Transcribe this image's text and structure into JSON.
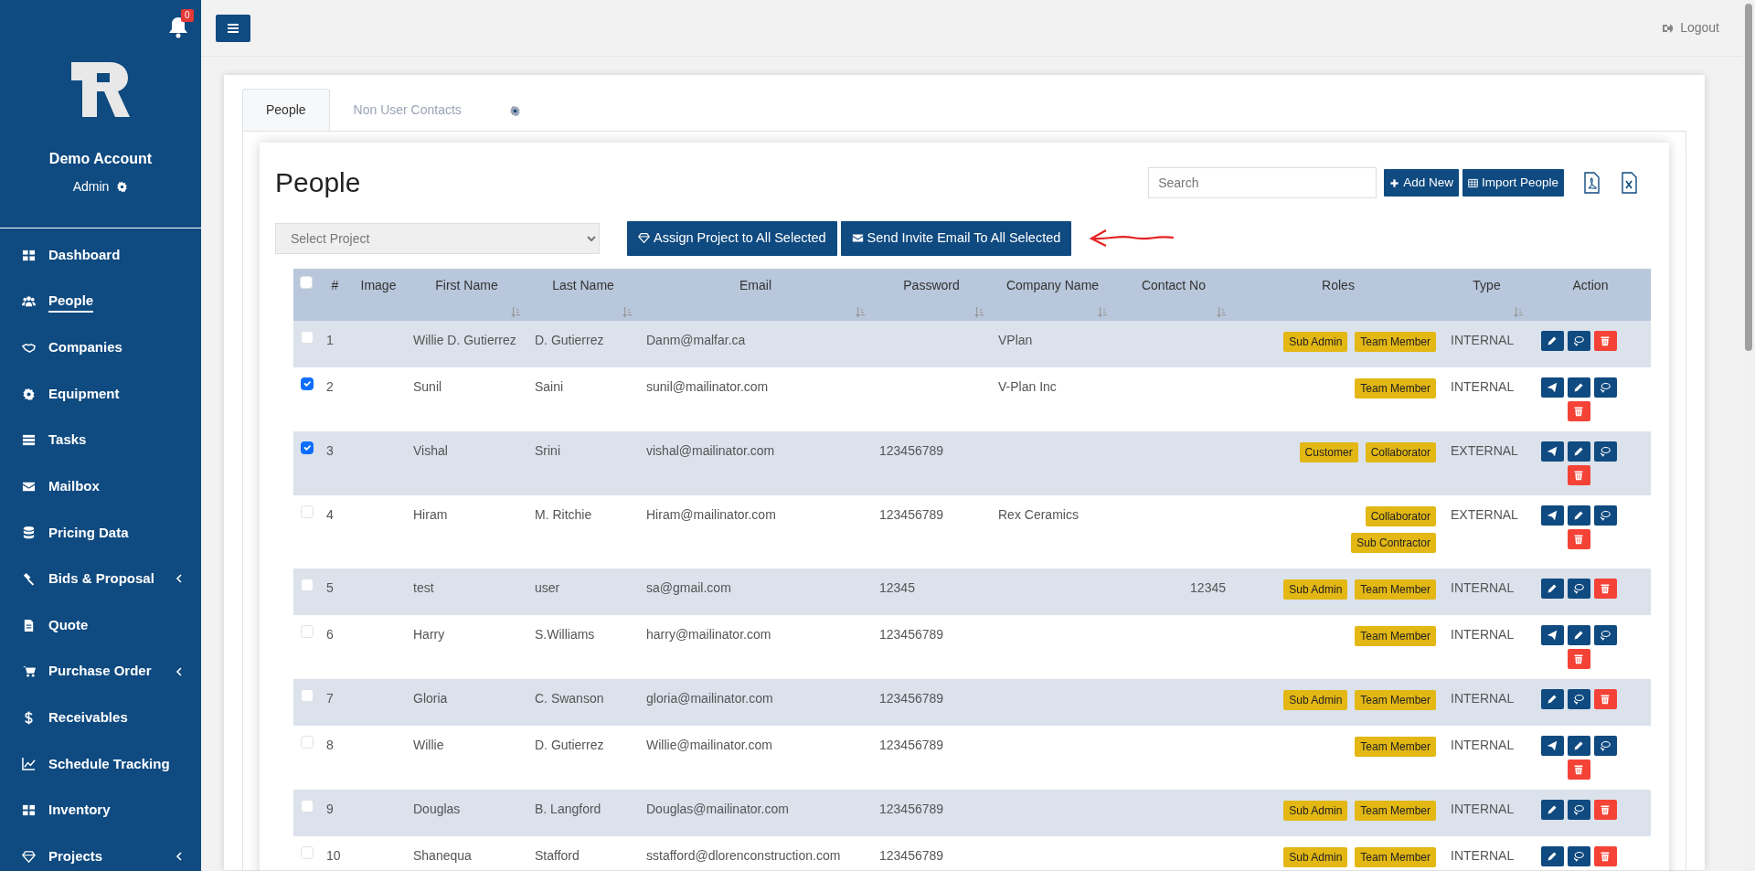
{
  "notifications": {
    "count": "0"
  },
  "account": {
    "name": "Demo Account",
    "role": "Admin"
  },
  "sidebar": {
    "items": [
      {
        "label": "Dashboard",
        "selected": false,
        "submenu": false
      },
      {
        "label": "People",
        "selected": true,
        "submenu": false
      },
      {
        "label": "Companies",
        "selected": false,
        "submenu": false
      },
      {
        "label": "Equipment",
        "selected": false,
        "submenu": false
      },
      {
        "label": "Tasks",
        "selected": false,
        "submenu": false
      },
      {
        "label": "Mailbox",
        "selected": false,
        "submenu": false
      },
      {
        "label": "Pricing Data",
        "selected": false,
        "submenu": false
      },
      {
        "label": "Bids & Proposal",
        "selected": false,
        "submenu": true
      },
      {
        "label": "Quote",
        "selected": false,
        "submenu": false
      },
      {
        "label": "Purchase Order",
        "selected": false,
        "submenu": true
      },
      {
        "label": "Receivables",
        "selected": false,
        "submenu": false
      },
      {
        "label": "Schedule Tracking",
        "selected": false,
        "submenu": false
      },
      {
        "label": "Inventory",
        "selected": false,
        "submenu": false
      },
      {
        "label": "Projects",
        "selected": false,
        "submenu": true
      }
    ]
  },
  "topbar": {
    "logout": "Logout"
  },
  "tabs": [
    {
      "kind": "text",
      "label": "People",
      "selected": true
    },
    {
      "kind": "text",
      "label": "Non User Contacts",
      "selected": false
    },
    {
      "kind": "icon",
      "selected": false
    }
  ],
  "title": "People",
  "search": {
    "placeholder": "Search"
  },
  "buttons": [
    {
      "label": "Add New"
    },
    {
      "label": "Import People"
    }
  ],
  "project_select": {
    "placeholder": "Select Project"
  },
  "bulk_buttons": [
    {
      "label": "Assign Project to All Selected"
    },
    {
      "label": "Send Invite Email To All Selected"
    }
  ],
  "annotation": {
    "kind": "arrow"
  },
  "table": {
    "all_checked": false,
    "columns": [
      {
        "label": "#",
        "sortable": false
      },
      {
        "label": "Image",
        "sortable": false
      },
      {
        "label": "First Name",
        "sortable": true
      },
      {
        "label": "Last Name",
        "sortable": true
      },
      {
        "label": "Email",
        "sortable": true
      },
      {
        "label": "Password",
        "sortable": true
      },
      {
        "label": "Company Name",
        "sortable": true
      },
      {
        "label": "Contact No",
        "sortable": true
      },
      {
        "label": "Roles",
        "sortable": false
      },
      {
        "label": "Type",
        "sortable": true
      },
      {
        "label": "Action",
        "sortable": false
      }
    ],
    "rows": [
      {
        "checked": false,
        "no": "1",
        "first": "Willie D. Gutierrez",
        "last": "D. Gutierrez",
        "email": "Danm@malfar.ca",
        "password": "",
        "company": "VPlan",
        "contact": "",
        "roles": [
          "Sub Admin",
          "Team Member"
        ],
        "type": "INTERNAL",
        "actions": [
          {
            "kind": "edit"
          },
          {
            "kind": "chat"
          },
          {
            "kind": "delete"
          }
        ]
      },
      {
        "checked": true,
        "no": "2",
        "first": "Sunil",
        "last": "Saini",
        "email": "sunil@mailinator.com",
        "password": "",
        "company": "V-Plan Inc",
        "contact": "",
        "roles": [
          "Team Member"
        ],
        "type": "INTERNAL",
        "actions": [
          {
            "kind": "send"
          },
          {
            "kind": "edit"
          },
          {
            "kind": "chat"
          },
          {
            "kind": "delete"
          }
        ]
      },
      {
        "checked": true,
        "no": "3",
        "first": "Vishal",
        "last": "Srini",
        "email": "vishal@mailinator.com",
        "password": "123456789",
        "company": "",
        "contact": "",
        "roles": [
          "Customer",
          "Collaborator"
        ],
        "type": "EXTERNAL",
        "actions": [
          {
            "kind": "send"
          },
          {
            "kind": "edit"
          },
          {
            "kind": "chat"
          },
          {
            "kind": "delete"
          }
        ]
      },
      {
        "checked": false,
        "no": "4",
        "first": "Hiram",
        "last": "M. Ritchie",
        "email": "Hiram@mailinator.com",
        "password": "123456789",
        "company": "Rex Ceramics",
        "contact": "",
        "roles": [
          "Collaborator",
          "Sub Contractor"
        ],
        "type": "EXTERNAL",
        "actions": [
          {
            "kind": "send"
          },
          {
            "kind": "edit"
          },
          {
            "kind": "chat"
          },
          {
            "kind": "delete"
          }
        ]
      },
      {
        "checked": false,
        "no": "5",
        "first": "test",
        "last": "user",
        "email": "sa@gmail.com",
        "password": "12345",
        "company": "",
        "contact": "12345",
        "roles": [
          "Sub Admin",
          "Team Member"
        ],
        "type": "INTERNAL",
        "actions": [
          {
            "kind": "edit"
          },
          {
            "kind": "chat"
          },
          {
            "kind": "delete"
          }
        ]
      },
      {
        "checked": false,
        "no": "6",
        "first": "Harry",
        "last": "S.Williams",
        "email": "harry@mailinator.com",
        "password": "123456789",
        "company": "",
        "contact": "",
        "roles": [
          "Team Member"
        ],
        "type": "INTERNAL",
        "actions": [
          {
            "kind": "send"
          },
          {
            "kind": "edit"
          },
          {
            "kind": "chat"
          },
          {
            "kind": "delete"
          }
        ]
      },
      {
        "checked": false,
        "no": "7",
        "first": "Gloria",
        "last": "C. Swanson",
        "email": "gloria@mailinator.com",
        "password": "123456789",
        "company": "",
        "contact": "",
        "roles": [
          "Sub Admin",
          "Team Member"
        ],
        "type": "INTERNAL",
        "actions": [
          {
            "kind": "edit"
          },
          {
            "kind": "chat"
          },
          {
            "kind": "delete"
          }
        ]
      },
      {
        "checked": false,
        "no": "8",
        "first": "Willie",
        "last": "D. Gutierrez",
        "email": "Willie@mailinator.com",
        "password": "123456789",
        "company": "",
        "contact": "",
        "roles": [
          "Team Member"
        ],
        "type": "INTERNAL",
        "actions": [
          {
            "kind": "send"
          },
          {
            "kind": "edit"
          },
          {
            "kind": "chat"
          },
          {
            "kind": "delete"
          }
        ]
      },
      {
        "checked": false,
        "no": "9",
        "first": "Douglas",
        "last": "B. Langford",
        "email": "Douglas@mailinator.com",
        "password": "123456789",
        "company": "",
        "contact": "",
        "roles": [
          "Sub Admin",
          "Team Member"
        ],
        "type": "INTERNAL",
        "actions": [
          {
            "kind": "edit"
          },
          {
            "kind": "chat"
          },
          {
            "kind": "delete"
          }
        ]
      },
      {
        "checked": false,
        "no": "10",
        "first": "Shanequa",
        "last": "Stafford",
        "email": "sstafford@dlorenconstruction.com",
        "password": "123456789",
        "company": "",
        "contact": "",
        "roles": [
          "Sub Admin",
          "Team Member"
        ],
        "type": "INTERNAL",
        "actions": [
          {
            "kind": "edit"
          },
          {
            "kind": "chat"
          },
          {
            "kind": "delete"
          }
        ]
      }
    ]
  }
}
